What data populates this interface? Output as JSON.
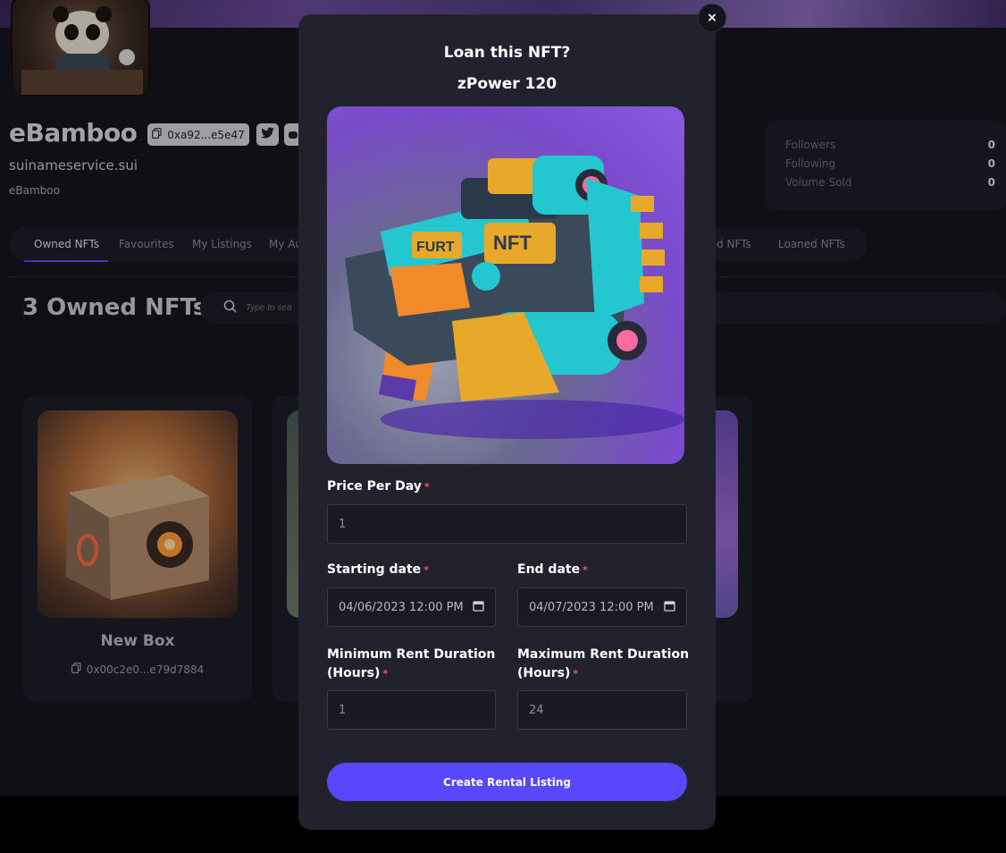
{
  "profile": {
    "name": "eBamboo",
    "address": "0xa92...e5e47",
    "sui_name": "suinameservice.sui",
    "handle": "eBamboo"
  },
  "stats": [
    {
      "label": "Followers",
      "value": "0"
    },
    {
      "label": "Following",
      "value": "0"
    },
    {
      "label": "Volume Sold",
      "value": "0"
    }
  ],
  "tabs": [
    {
      "label": "Owned NFTs"
    },
    {
      "label": "Favourites"
    },
    {
      "label": "My Listings"
    },
    {
      "label": "My Au"
    },
    {
      "label": "red NFTs"
    },
    {
      "label": "Loaned NFTs"
    }
  ],
  "owned": {
    "title": "3 Owned NFTs",
    "search_placeholder": "Type to sea"
  },
  "cards": [
    {
      "name": "New Box",
      "address": "0x00c2e0...e79d7884"
    }
  ],
  "modal": {
    "title": "Loan this NFT?",
    "nft_name": "zPower 120",
    "price_label": "Price Per Day",
    "price_value": "1",
    "start_label": "Starting date",
    "start_value": "04/06/2023 12:00 PM",
    "end_label": "End date",
    "end_value": "04/07/2023 12:00 PM",
    "min_label_1": "Minimum Rent Duration",
    "min_label_2": "(Hours)",
    "min_value": "1",
    "max_label_1": "Maximum Rent Duration",
    "max_label_2": "(Hours)",
    "max_value": "24",
    "required_mark": "*",
    "submit_label": "Create Rental Listing",
    "close_glyph": "×"
  }
}
